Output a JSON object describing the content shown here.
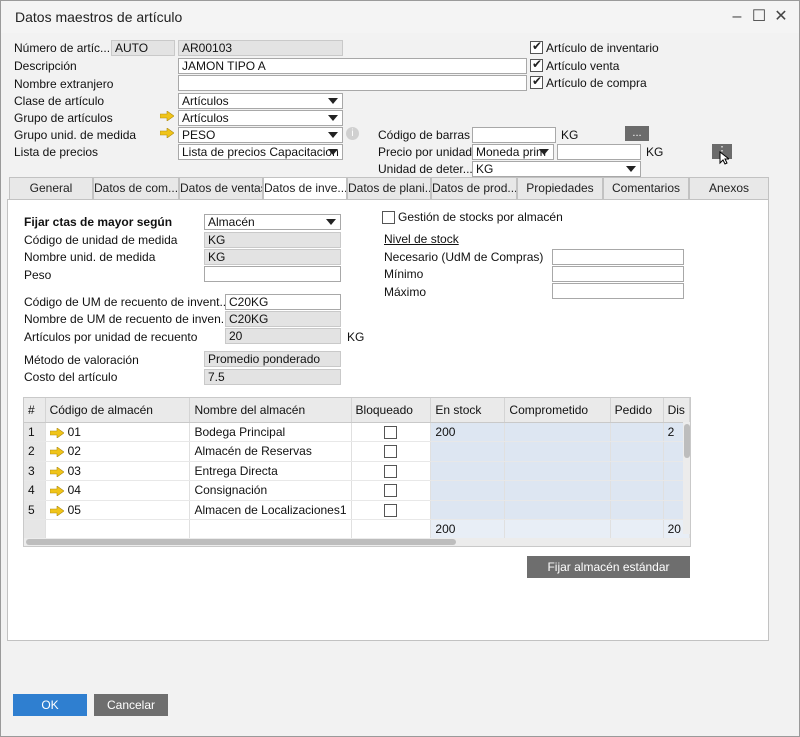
{
  "window": {
    "title": "Datos maestros de artículo",
    "minimize_icon": "minimize-icon",
    "maximize_icon": "maximize-icon",
    "close_icon": "close-icon"
  },
  "header": {
    "item_number_label": "Número de artíc...",
    "series_value": "AUTO",
    "item_number_value": "AR00103",
    "description_label": "Descripción",
    "description_value": "JAMON TIPO A",
    "foreign_name_label": "Nombre extranjero",
    "foreign_name_value": "",
    "item_class_label": "Clase de artículo",
    "item_class_value": "Artículos",
    "item_group_label": "Grupo de artículos",
    "item_group_value": "Artículos",
    "uom_group_label": "Grupo unid. de medida",
    "uom_group_value": "PESO",
    "price_list_label": "Lista de precios",
    "price_list_value": "Lista de precios Capacitacion",
    "inventory_item_label": "Artículo de inventario",
    "sales_item_label": "Artículo venta",
    "purchase_item_label": "Artículo de compra",
    "barcode_label": "Código de barras",
    "barcode_value": "",
    "barcode_unit": "KG",
    "barcode_button": "...",
    "unit_price_label": "Precio por unidad",
    "currency_value": "Moneda prim",
    "unit_price_value": "",
    "unit_price_unit": "KG",
    "pricing_unit_label": "Unidad de deter...",
    "pricing_unit_value": "KG"
  },
  "tabs": [
    {
      "label": "General"
    },
    {
      "label": "Datos de com..."
    },
    {
      "label": "Datos de ventas"
    },
    {
      "label": "Datos de inve..."
    },
    {
      "label": "Datos de plani..."
    },
    {
      "label": "Datos de prod..."
    },
    {
      "label": "Propiedades"
    },
    {
      "label": "Comentarios"
    },
    {
      "label": "Anexos"
    }
  ],
  "inventory": {
    "gl_method_label": "Fijar ctas de mayor según",
    "gl_method_value": "Almacén",
    "uom_code_label": "Código de unidad de medida",
    "uom_code_value": "KG",
    "uom_name_label": "Nombre unid. de medida",
    "uom_name_value": "KG",
    "weight_label": "Peso",
    "weight_value": "",
    "count_uom_code_label": "Código de UM de recuento de invent...",
    "count_uom_code_value": "C20KG",
    "count_uom_name_label": "Nombre de UM de recuento de inven...",
    "count_uom_name_value": "C20KG",
    "items_per_count_label": "Artículos por unidad de recuento",
    "items_per_count_value": "20",
    "items_per_count_unit": "KG",
    "valuation_label": "Método de valoración",
    "valuation_value": "Promedio ponderado",
    "item_cost_label": "Costo del artículo",
    "item_cost_value": "7.5",
    "stock_by_whs_label": "Gestión de stocks por almacén",
    "stock_level_label": "Nivel de stock",
    "required_label": "Necesario (UdM de Compras)",
    "required_value": "",
    "minimum_label": "Mínimo",
    "minimum_value": "",
    "maximum_label": "Máximo",
    "maximum_value": ""
  },
  "warehouses": {
    "columns": [
      "#",
      "Código de almacén",
      "Nombre del almacén",
      "Bloqueado",
      "En stock",
      "Comprometido",
      "Pedido",
      "Dis"
    ],
    "rows": [
      {
        "n": "1",
        "code": "01",
        "name": "Bodega Principal",
        "in_stock": "200",
        "extra": "2"
      },
      {
        "n": "2",
        "code": "02",
        "name": "Almacén de Reservas",
        "in_stock": "",
        "extra": ""
      },
      {
        "n": "3",
        "code": "03",
        "name": "Entrega Directa",
        "in_stock": "",
        "extra": ""
      },
      {
        "n": "4",
        "code": "04",
        "name": "Consignación",
        "in_stock": "",
        "extra": ""
      },
      {
        "n": "5",
        "code": "05",
        "name": "Almacen de Localizaciones1",
        "in_stock": "",
        "extra": ""
      }
    ],
    "total_in_stock": "200",
    "total_extra": "20",
    "set_default_button": "Fijar almacén estándar"
  },
  "footer": {
    "ok_button": "OK",
    "cancel_button": "Cancelar"
  },
  "colors": {
    "ok_blue": "#2f7fd0",
    "cancel_gray": "#6e6e6e",
    "link_arrow": "#f0c419",
    "grid_blue": "#dde6f2"
  }
}
